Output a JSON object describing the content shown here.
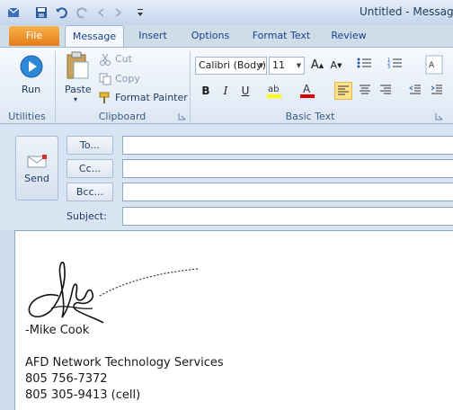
{
  "window": {
    "title": "Untitled - Message"
  },
  "tabs": {
    "file": "File",
    "message": "Message",
    "insert": "Insert",
    "options": "Options",
    "format_text": "Format Text",
    "review": "Review"
  },
  "ribbon": {
    "run_label": "Run",
    "utilities_label": "Utilities",
    "paste_label": "Paste",
    "cut_label": "Cut",
    "copy_label": "Copy",
    "format_painter_label": "Format Painter",
    "clipboard_label": "Clipboard",
    "font_name": "Calibri (Body)",
    "font_size": "11",
    "bold": "B",
    "italic": "I",
    "underline": "U",
    "basic_text_label": "Basic Text"
  },
  "compose": {
    "send_label": "Send",
    "to_label": "To...",
    "cc_label": "Cc...",
    "bcc_label": "Bcc...",
    "subject_label": "Subject:",
    "to_value": "",
    "cc_value": "",
    "bcc_value": "",
    "subject_value": ""
  },
  "signature": {
    "name": "-Mike Cook",
    "company": "AFD Network Technology Services",
    "phone": "805 756-7372",
    "cell": "805 305-9413 (cell)"
  },
  "colors": {
    "file_tab": "#e47b16",
    "ribbon_bg": "#e5edf7",
    "highlight": "#ffff00",
    "font_color": "#e00000"
  }
}
